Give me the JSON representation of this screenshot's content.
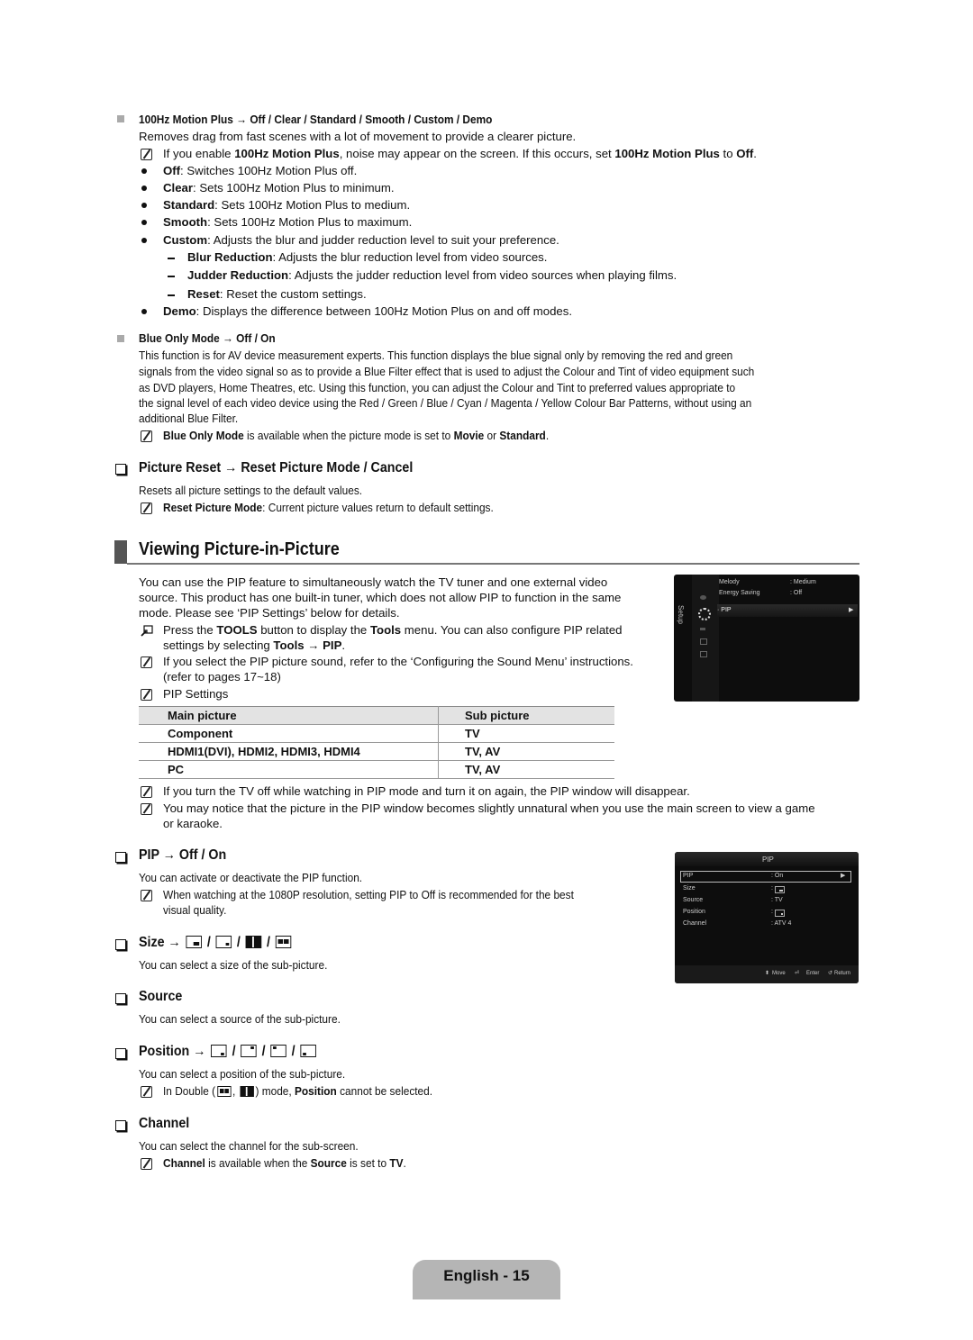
{
  "motion_plus": {
    "heading": "100Hz Motion Plus → Off / Clear / Standard / Smooth / Custom / Demo",
    "desc": "Removes drag from fast scenes with a lot of movement to provide a clearer picture.",
    "note": {
      "pre": "If you enable ",
      "b1": "100Hz Motion Plus",
      "mid": ", noise may appear on the screen. If this occurs, set ",
      "b2": "100Hz Motion Plus",
      "mid2": " to ",
      "b3": "Off",
      "end": "."
    },
    "options": [
      {
        "term": "Off",
        "text": ": Switches 100Hz Motion Plus off."
      },
      {
        "term": "Clear",
        "text": ": Sets 100Hz Motion Plus to minimum."
      },
      {
        "term": "Standard",
        "text": ": Sets 100Hz Motion Plus to medium."
      },
      {
        "term": "Smooth",
        "text": ": Sets 100Hz Motion Plus to maximum."
      },
      {
        "term": "Custom",
        "text": ": Adjusts the blur and judder reduction level to suit your preference."
      }
    ],
    "custom_sub": [
      {
        "term": "Blur Reduction",
        "text": ": Adjusts the blur reduction level from video sources."
      },
      {
        "term": "Judder Reduction",
        "text": ": Adjusts the judder reduction level from video sources when playing films."
      },
      {
        "term": "Reset",
        "text": ": Reset the custom settings."
      }
    ],
    "demo": {
      "term": "Demo",
      "text": ": Displays the difference between 100Hz Motion Plus on and off modes."
    }
  },
  "blue_only": {
    "heading": "Blue Only Mode → Off / On",
    "lines": [
      "This function is for AV device measurement experts. This function displays the blue signal only by removing the red and green",
      "signals from the video signal so as to provide a Blue Filter effect that is used to adjust the Colour and Tint of video equipment such",
      "as DVD players, Home Theatres, etc. Using this function, you can adjust the Colour and Tint to preferred values appropriate to",
      "the signal level of each video device using the Red / Green / Blue / Cyan / Magenta / Yellow Colour Bar Patterns, without using an",
      "additional Blue Filter."
    ],
    "note": {
      "b1": "Blue Only Mode",
      "mid": " is available when the picture mode is set to ",
      "b2": "Movie",
      "mid2": " or ",
      "b3": "Standard",
      "end": "."
    }
  },
  "picture_reset": {
    "heading": "Picture Reset → Reset Picture Mode / Cancel",
    "desc": "Resets all picture settings to the default values.",
    "note": {
      "b1": "Reset Picture Mode",
      "text": ": Current picture values return to default settings."
    }
  },
  "pip_section": {
    "title": "Viewing Picture-in-Picture",
    "intro": [
      "You can use the PIP feature to simultaneously watch the TV tuner and one external video",
      "source. This product has one built-in tuner, which does not allow PIP to function in the same",
      "mode. Please see ‘PIP Settings’ below for details."
    ],
    "tools_note": {
      "pre": "Press the ",
      "b1": "TOOLS",
      "mid": " button to display the ",
      "b2": "Tools",
      "mid2": " menu. You can also configure PIP related",
      "line2_pre": "settings by selecting ",
      "b3": "Tools → PIP",
      "end": "."
    },
    "sound_note": [
      "If you select the PIP picture sound, refer to the ‘Configuring the Sound Menu’ instructions.",
      "(refer to pages 17~18)"
    ],
    "settings_note": "PIP Settings",
    "table": {
      "headers": [
        "Main picture",
        "Sub picture"
      ],
      "rows": [
        [
          "Component",
          "TV"
        ],
        [
          "HDMI1(DVI), HDMI2, HDMI3, HDMI4",
          "TV, AV"
        ],
        [
          "PC",
          "TV, AV"
        ]
      ]
    },
    "after_notes": [
      "If you turn the TV off while watching in PIP mode and turn it on again, the PIP window will disappear.",
      "You may notice that the picture in the PIP window becomes slightly unnatural when you use the main screen to view a game",
      "or karaoke."
    ]
  },
  "setup_menu": {
    "side_label": "Setup",
    "rows": [
      {
        "label": "Melody",
        "value": ": Medium"
      },
      {
        "label": "Energy Saving",
        "value": ": Off"
      }
    ],
    "selected": "· PIP",
    "arrow": "▶"
  },
  "pip_menu": {
    "title": "PIP",
    "rows": [
      {
        "label": "PIP",
        "value": ": On",
        "selected": true
      },
      {
        "label": "Size",
        "value": ":"
      },
      {
        "label": "Source",
        "value": ": TV"
      },
      {
        "label": "Position",
        "value": ":"
      },
      {
        "label": "Channel",
        "value": ": ATV 4"
      }
    ],
    "footer": {
      "move": "Move",
      "enter": "Enter",
      "return": "Return"
    }
  },
  "pip_onoff": {
    "heading": "PIP → Off / On",
    "desc": "You can activate or deactivate the PIP function.",
    "note": [
      "When watching at the 1080P resolution, setting PIP to Off is recommended for the best",
      "visual quality."
    ]
  },
  "size": {
    "heading": "Size →",
    "desc": "You can select a size of the sub-picture."
  },
  "source": {
    "heading": "Source",
    "desc": "You can select a source of the sub-picture."
  },
  "position": {
    "heading": "Position →",
    "desc": "You can select a position of the sub-picture.",
    "note": {
      "pre": "In Double (",
      "mid": ") mode, ",
      "b1": "Position",
      "end": " cannot be selected."
    }
  },
  "channel": {
    "heading": "Channel",
    "desc": "You can select the channel for the sub-screen.",
    "note": {
      "b1": "Channel",
      "mid": " is available when the ",
      "b2": "Source",
      "mid2": " is set to ",
      "b3": "TV",
      "end": "."
    }
  },
  "footer": {
    "page_label": "English - 15"
  }
}
